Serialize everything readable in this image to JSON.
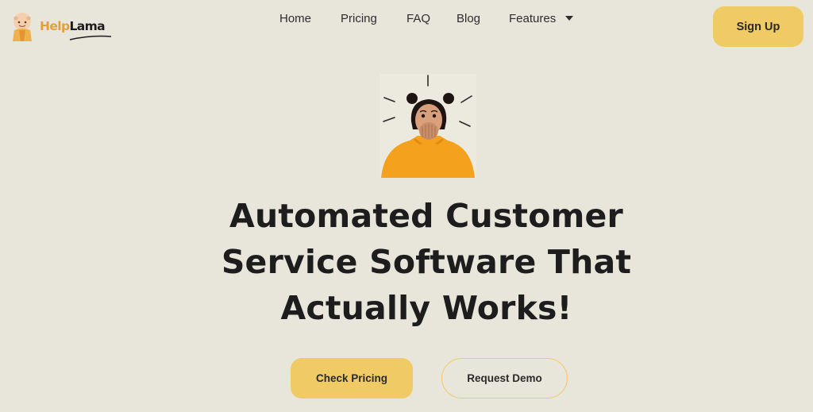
{
  "header": {
    "logo": {
      "part1": "Help",
      "part2": "Lama",
      "icon": "monk-mascot-icon"
    },
    "nav": [
      {
        "label": "Home"
      },
      {
        "label": "Pricing"
      },
      {
        "label": "FAQ"
      },
      {
        "label": "Blog"
      },
      {
        "label": "Features",
        "icon": "caret-down-icon"
      }
    ],
    "signup_label": "Sign Up"
  },
  "hero": {
    "image": "surprised-woman-illustration",
    "headline_lines": [
      "Automated Customer",
      "Service Software That",
      "Actually Works!"
    ],
    "primary_cta": "Check Pricing",
    "secondary_cta": "Request Demo"
  },
  "colors": {
    "background": "#e8e5db",
    "accent": "#f0ca64",
    "text": "#1c1c1c",
    "logo_orange": "#e0a13a"
  }
}
